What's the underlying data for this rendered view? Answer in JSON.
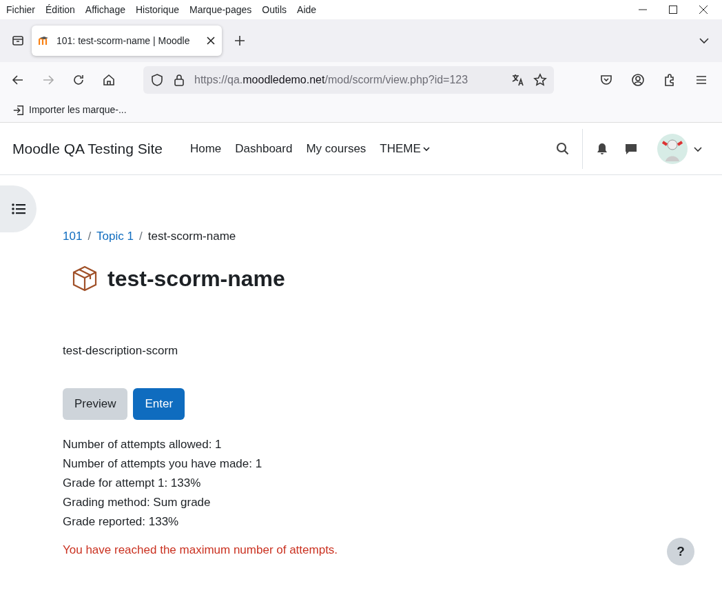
{
  "menu_bar": [
    "Fichier",
    "Édition",
    "Affichage",
    "Historique",
    "Marque-pages",
    "Outils",
    "Aide"
  ],
  "tabs": [
    {
      "title": "101: test-scorm-name | Moodle",
      "selected": true
    }
  ],
  "address_bar": {
    "scheme": "https://qa.",
    "host": "moodledemo.net",
    "path": "/mod/scorm/view.php?id=123"
  },
  "bookmarks": [
    "Importer les marque-..."
  ],
  "site": {
    "name": "Moodle QA Testing Site",
    "nav": [
      {
        "label": "Home",
        "kind": "link"
      },
      {
        "label": "Dashboard",
        "kind": "link"
      },
      {
        "label": "My courses",
        "kind": "link"
      },
      {
        "label": "THEME",
        "kind": "dropdown"
      }
    ]
  },
  "breadcrumb_separator": "/",
  "breadcrumb": [
    {
      "label": "101",
      "link": true
    },
    {
      "label": "Topic 1",
      "link": true
    },
    {
      "label": "test-scorm-name",
      "link": false
    }
  ],
  "title": "test-scorm-name",
  "description": "test-description-scorm",
  "buttons": [
    {
      "label": "Preview",
      "kind": "secondary"
    },
    {
      "label": "Enter",
      "kind": "primary"
    }
  ],
  "info": [
    "Number of attempts allowed: 1",
    "Number of attempts you have made: 1",
    "Grade for attempt 1: 133%",
    "Grading method: Sum grade",
    "Grade reported: 133%"
  ],
  "warning": "You have reached the maximum number of attempts.",
  "help_button": "?"
}
